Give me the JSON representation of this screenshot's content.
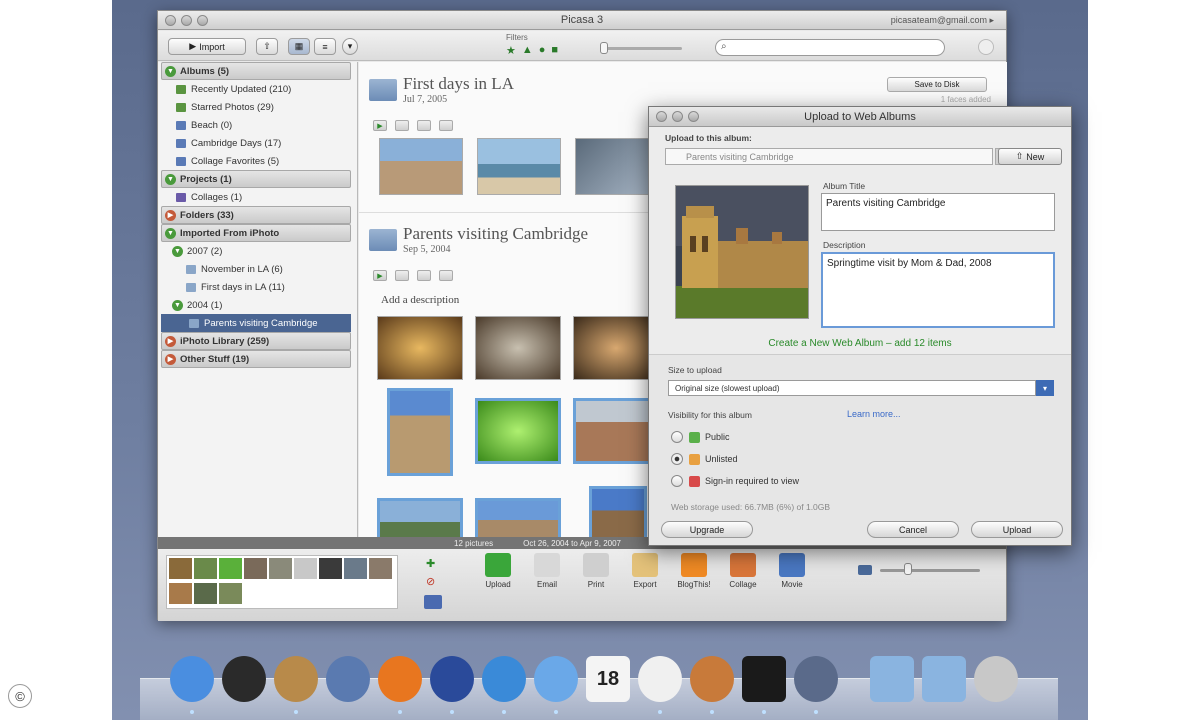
{
  "window": {
    "title": "Picasa 3",
    "account": "picasateam@gmail.com ▸"
  },
  "toolbar": {
    "import_label": "Import",
    "filters_label": "Filters",
    "search_placeholder": ""
  },
  "sidebar": {
    "groups": [
      {
        "label": "Albums (5)",
        "state": "open",
        "items": [
          {
            "label": "Recently Updated (210)",
            "icon": "album"
          },
          {
            "label": "Starred Photos (29)",
            "icon": "album"
          },
          {
            "label": "Beach (0)",
            "icon": "blue"
          },
          {
            "label": "Cambridge Days (17)",
            "icon": "blue"
          },
          {
            "label": "Collage Favorites (5)",
            "icon": "blue"
          }
        ]
      },
      {
        "label": "Projects (1)",
        "state": "open",
        "items": [
          {
            "label": "Collages (1)",
            "icon": "purple"
          }
        ]
      },
      {
        "label": "Folders (33)",
        "state": "closed",
        "items": []
      },
      {
        "label": "Imported From iPhoto",
        "state": "open",
        "items": []
      }
    ],
    "iphoto": {
      "year_2007": "2007 (2)",
      "nov": "November in LA (6)",
      "first": "First days in LA (11)",
      "year_2004": "2004 (1)",
      "parents": "Parents visiting Cambridge"
    },
    "iphoto_library": "iPhoto Library (259)",
    "other_stuff": "Other Stuff (19)"
  },
  "content": {
    "album1": {
      "title": "First days in LA",
      "date": "Jul 7, 2005"
    },
    "album2": {
      "title": "Parents visiting Cambridge",
      "date": "Sep 5, 2004"
    },
    "add_description": "Add a description",
    "save_to_disk": "Save to Disk",
    "faces_hint": "1 faces added"
  },
  "status": {
    "count": "12 pictures",
    "range": "Oct 26, 2004 to Apr 9, 2007"
  },
  "tray_actions": [
    {
      "label": "Upload",
      "color": "#3aa63a"
    },
    {
      "label": "Email",
      "color": "#d8d8d8"
    },
    {
      "label": "Print",
      "color": "#cfcfcf"
    },
    {
      "label": "Export",
      "color": "#e4c27a"
    },
    {
      "label": "BlogThis!",
      "color": "#f08a24"
    },
    {
      "label": "Collage",
      "color": "#d9763a"
    },
    {
      "label": "Movie",
      "color": "#4a78c2"
    }
  ],
  "dialog": {
    "title": "Upload to Web Albums",
    "upload_to_label": "Upload to this album:",
    "upload_to_value": "Parents visiting Cambridge",
    "new_label": "New",
    "album_title_label": "Album Title",
    "album_title_value": "Parents visiting Cambridge",
    "description_label": "Description",
    "description_value": "Springtime visit by Mom & Dad, 2008",
    "create_link": "Create a New Web Album – add 12 items",
    "size_label": "Size to upload",
    "size_value": "Original size (slowest upload)",
    "visibility_label": "Visibility for this album",
    "learn_more": "Learn more...",
    "vis_public": "Public",
    "vis_unlisted": "Unlisted",
    "vis_signin": "Sign-in required to view",
    "storage": "Web storage used: 66.7MB (6%) of 1.0GB",
    "upgrade": "Upgrade",
    "cancel": "Cancel",
    "upload": "Upload"
  },
  "dock": [
    {
      "name": "finder-icon",
      "color": "#4a8ee0"
    },
    {
      "name": "dashboard-icon",
      "color": "#2a2a2a"
    },
    {
      "name": "address-book-icon",
      "color": "#b88a4a"
    },
    {
      "name": "preview-icon",
      "color": "#5a7ab0"
    },
    {
      "name": "firefox-icon",
      "color": "#e8761f"
    },
    {
      "name": "google-earth-icon",
      "color": "#2a4a9a"
    },
    {
      "name": "safari-icon",
      "color": "#3a8ad8"
    },
    {
      "name": "itunes-icon",
      "color": "#6aa8e8"
    },
    {
      "name": "ical-icon",
      "color": "#f4f4f4",
      "text": "18"
    },
    {
      "name": "picasa-icon",
      "color": "#f0f0f0"
    },
    {
      "name": "iphoto-icon",
      "color": "#c87a3a"
    },
    {
      "name": "terminal-icon",
      "color": "#1a1a1a"
    },
    {
      "name": "photo-booth-icon",
      "color": "#5a6a8a"
    },
    {
      "name": "applications-folder-icon",
      "color": "#8ab4e0"
    },
    {
      "name": "documents-folder-icon",
      "color": "#8ab4e0"
    },
    {
      "name": "trash-icon",
      "color": "#c8c8c8"
    }
  ]
}
